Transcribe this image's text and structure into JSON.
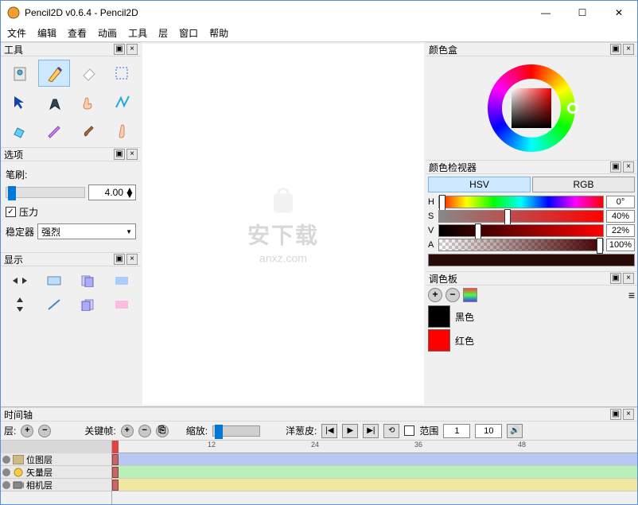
{
  "window": {
    "title": "Pencil2D v0.6.4 - Pencil2D",
    "minimize": "—",
    "maximize": "☐",
    "close": "✕"
  },
  "menu": {
    "items": [
      "文件",
      "编辑",
      "查看",
      "动画",
      "工具",
      "层",
      "窗口",
      "帮助"
    ]
  },
  "panels": {
    "tools": {
      "title": "工具"
    },
    "options": {
      "title": "选项",
      "brush_label": "笔刷:",
      "brush_value": "4.00",
      "pressure_label": "压力",
      "stabilizer_label": "稳定器",
      "stabilizer_value": "强烈"
    },
    "display": {
      "title": "显示"
    },
    "colorbox": {
      "title": "颜色盒"
    },
    "inspector": {
      "title": "颜色检视器",
      "tab_hsv": "HSV",
      "tab_rgb": "RGB",
      "h_label": "H",
      "h_value": "0°",
      "s_label": "S",
      "s_value": "40%",
      "v_label": "V",
      "v_value": "22%",
      "a_label": "A",
      "a_value": "100%"
    },
    "palette": {
      "title": "调色板",
      "items": [
        {
          "name": "黑色",
          "color": "#000000"
        },
        {
          "name": "红色",
          "color": "#ff0000"
        }
      ]
    },
    "timeline": {
      "title": "时间轴",
      "layer_label": "层:",
      "keyframe_label": "关键帧:",
      "zoom_label": "缩放:",
      "onion_label": "洋葱皮:",
      "range_label": "范围",
      "range_start": "1",
      "range_end": "10",
      "layers": [
        "位图层",
        "矢量层",
        "相机层"
      ],
      "ruler_marks": [
        "12",
        "24",
        "36",
        "48"
      ]
    }
  },
  "watermark": {
    "text": "安下载",
    "sub": "anxz.com"
  }
}
